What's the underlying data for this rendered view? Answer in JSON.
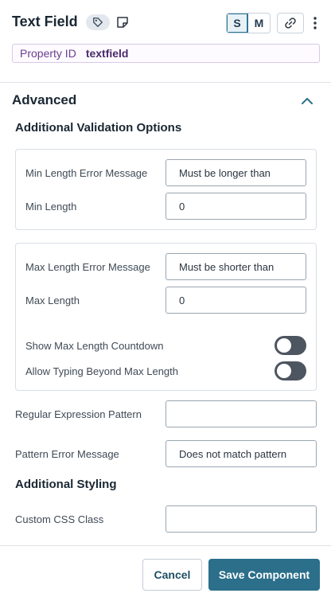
{
  "header": {
    "title": "Text Field",
    "size_small": "S",
    "size_medium": "M"
  },
  "property_id": {
    "label": "Property ID",
    "value": "textfield"
  },
  "advanced": {
    "title": "Advanced",
    "validation_title": "Additional Validation Options",
    "min_card": {
      "error_label": "Min Length Error Message",
      "error_value": "Must be longer than",
      "length_label": "Min Length",
      "length_value": "0"
    },
    "max_card": {
      "error_label": "Max Length Error Message",
      "error_value": "Must be shorter than",
      "length_label": "Max Length",
      "length_value": "0",
      "countdown_label": "Show Max Length Countdown",
      "countdown_on": false,
      "beyond_label": "Allow Typing Beyond Max Length",
      "beyond_on": false
    },
    "regex_label": "Regular Expression Pattern",
    "regex_value": "",
    "pattern_error_label": "Pattern Error Message",
    "pattern_error_value": "Does not match pattern",
    "styling_title": "Additional Styling",
    "css_class_label": "Custom CSS Class",
    "css_class_value": ""
  },
  "footer": {
    "cancel_label": "Cancel",
    "save_label": "Save Component"
  },
  "icons": {
    "tag": "tag-icon",
    "note": "note-icon",
    "link": "link-icon",
    "kebab": "kebab-menu-icon",
    "chevron": "chevron-up-icon"
  },
  "colors": {
    "primary": "#2b6f8a",
    "toggle_off": "#4d5560",
    "property_label": "#6b3d8e"
  }
}
